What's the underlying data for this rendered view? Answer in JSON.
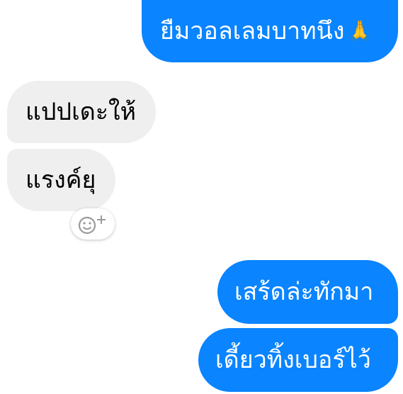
{
  "messages": [
    {
      "id": "m1",
      "direction": "outgoing",
      "text": "ยืมวอลเลมบาทนึง",
      "emoji": "🙏"
    },
    {
      "id": "m2",
      "direction": "incoming",
      "text": "แปปเดะให้"
    },
    {
      "id": "m3",
      "direction": "incoming",
      "text": "แรงค์ยุ"
    },
    {
      "id": "m4",
      "direction": "outgoing",
      "text": "เสร้ดล่ะทักมา"
    },
    {
      "id": "m5",
      "direction": "outgoing",
      "text": "เดี้ยวทิ้งเบอร์ไว้"
    }
  ],
  "reaction_button": {
    "icon": "add-reaction-icon"
  },
  "colors": {
    "outgoing_bubble": "#0a84ff",
    "incoming_bubble": "#efefef",
    "outgoing_text": "#ffffff",
    "incoming_text": "#000000"
  }
}
